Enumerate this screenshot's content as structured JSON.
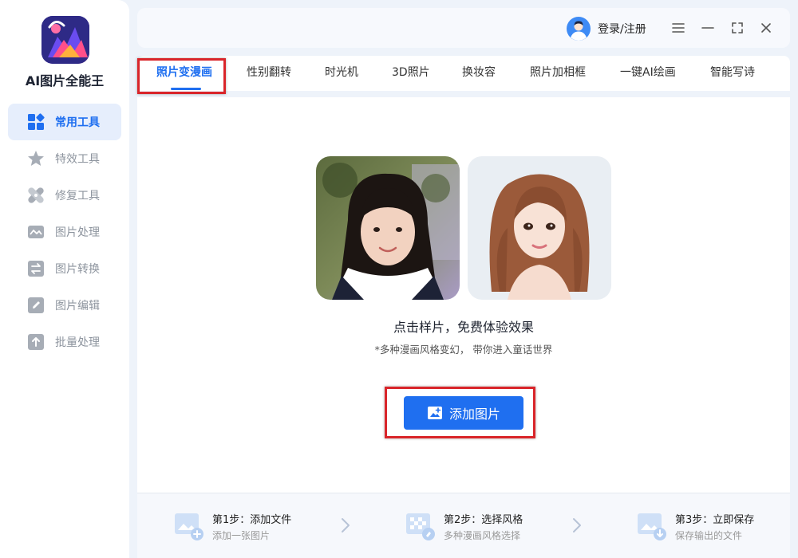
{
  "app": {
    "name": "AI图片全能王"
  },
  "sidebar": {
    "items": [
      {
        "label": "常用工具",
        "icon": "grid-icon",
        "active": true
      },
      {
        "label": "特效工具",
        "icon": "star-icon"
      },
      {
        "label": "修复工具",
        "icon": "bandage-icon"
      },
      {
        "label": "图片处理",
        "icon": "image-icon"
      },
      {
        "label": "图片转换",
        "icon": "convert-icon"
      },
      {
        "label": "图片编辑",
        "icon": "edit-icon"
      },
      {
        "label": "批量处理",
        "icon": "upload-icon"
      }
    ]
  },
  "header": {
    "login_label": "登录/注册"
  },
  "tabs": [
    {
      "label": "照片变漫画",
      "active": true
    },
    {
      "label": "性别翻转"
    },
    {
      "label": "时光机"
    },
    {
      "label": "3D照片"
    },
    {
      "label": "换妆容"
    },
    {
      "label": "照片加相框"
    },
    {
      "label": "一键AI绘画"
    },
    {
      "label": "智能写诗"
    }
  ],
  "main": {
    "title": "点击样片，免费体验效果",
    "subtitle": "*多种漫画风格变幻， 带你进入童话世界",
    "add_button_label": "添加图片"
  },
  "steps": [
    {
      "title": "第1步：添加文件",
      "desc": "添加一张图片"
    },
    {
      "title": "第2步：选择风格",
      "desc": "多种漫画风格选择"
    },
    {
      "title": "第3步：立即保存",
      "desc": "保存输出的文件"
    }
  ],
  "colors": {
    "accent": "#1f6ff0",
    "highlight": "#d9252a",
    "sidebar_active_bg": "#e6eefc",
    "page_bg": "#eef3fa"
  }
}
